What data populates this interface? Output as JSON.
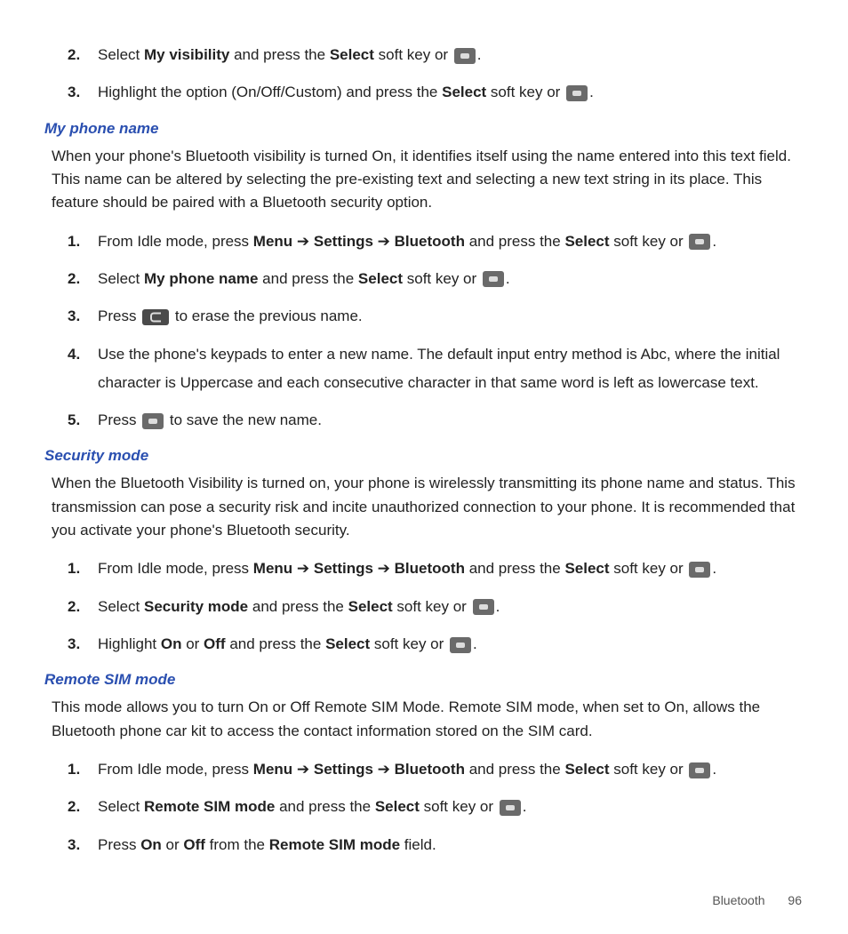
{
  "intro_steps": [
    {
      "n": "2.",
      "pre": "Select ",
      "b1": "My visibility",
      "mid": " and press the ",
      "b2": "Select",
      "post": " soft key or ",
      "icon": "ok",
      "tail": "."
    },
    {
      "n": "3.",
      "pre": "Highlight the option (On/Off/Custom) and press the ",
      "b1": "Select",
      "mid": "",
      "b2": "",
      "post": " soft key or ",
      "icon": "ok",
      "tail": "."
    }
  ],
  "sec_phone": {
    "heading": "My phone name",
    "para": "When your phone's Bluetooth visibility is turned On, it identifies itself using the name entered into this text field. This name can be altered by selecting the pre-existing text and selecting a new text string in its place. This feature should be paired with a Bluetooth security option.",
    "steps": [
      {
        "n": "1.",
        "type": "menu",
        "pre": "From Idle mode, press ",
        "m1": "Menu",
        "a1": " ➔ ",
        "m2": "Settings",
        "a2": " ➔ ",
        "m3": "Bluetooth",
        "mid": " and press the ",
        "b": "Select",
        "post": " soft key or ",
        "icon": "ok",
        "tail": "."
      },
      {
        "n": "2.",
        "type": "sel",
        "pre": "Select ",
        "b1": "My phone name",
        "mid": " and press the ",
        "b2": "Select",
        "post": " soft key or ",
        "icon": "ok",
        "tail": "."
      },
      {
        "n": "3.",
        "type": "press",
        "pre": "Press ",
        "icon": "c",
        "post": " to erase the previous name."
      },
      {
        "n": "4.",
        "type": "plain",
        "text": "Use the phone's keypads to enter a new name. The default input entry method is Abc, where the initial character is Uppercase and each consecutive character in that same word is left as lowercase text."
      },
      {
        "n": "5.",
        "type": "press",
        "pre": "Press ",
        "icon": "ok",
        "post": " to save the new name."
      }
    ]
  },
  "sec_security": {
    "heading": "Security mode",
    "para": "When the Bluetooth Visibility is turned on, your phone is wirelessly transmitting its phone name and status. This transmission can pose a security risk and incite unauthorized connection to your phone. It is recommended that you activate your phone's Bluetooth security.",
    "steps": [
      {
        "n": "1.",
        "type": "menu",
        "pre": "From Idle mode, press ",
        "m1": "Menu",
        "a1": " ➔ ",
        "m2": "Settings",
        "a2": " ➔ ",
        "m3": "Bluetooth",
        "mid": " and press the ",
        "b": "Select",
        "post": " soft key or ",
        "icon": "ok",
        "tail": "."
      },
      {
        "n": "2.",
        "type": "sel",
        "pre": "Select ",
        "b1": "Security mode",
        "mid": " and press the ",
        "b2": "Select",
        "post": " soft key or ",
        "icon": "ok",
        "tail": "."
      },
      {
        "n": "3.",
        "type": "onoff",
        "pre": "Highlight ",
        "b1": "On",
        "mid1": " or ",
        "b2": "Off",
        "mid2": " and press the ",
        "b3": "Select",
        "post": " soft key or ",
        "icon": "ok",
        "tail": "."
      }
    ]
  },
  "sec_sim": {
    "heading": "Remote SIM mode",
    "para": "This mode allows you to turn On or Off Remote SIM Mode. Remote SIM mode, when set to On, allows the Bluetooth phone car kit to access the contact information stored on the SIM card.",
    "steps": [
      {
        "n": "1.",
        "type": "menu",
        "pre": "From Idle mode, press ",
        "m1": "Menu",
        "a1": " ➔ ",
        "m2": "Settings",
        "a2": " ➔ ",
        "m3": "Bluetooth",
        "mid": " and press the ",
        "b": "Select",
        "post": " soft key or ",
        "icon": "ok",
        "tail": "."
      },
      {
        "n": "2.",
        "type": "sel",
        "pre": "Select ",
        "b1": "Remote SIM mode",
        "mid": " and press the ",
        "b2": "Select",
        "post": " soft key or ",
        "icon": "ok",
        "tail": "."
      },
      {
        "n": "3.",
        "type": "sim3",
        "pre": "Press ",
        "b1": "On",
        "mid1": " or ",
        "b2": "Off",
        "mid2": " from the ",
        "b3": "Remote SIM mode",
        "post": " field."
      }
    ]
  },
  "footer": {
    "section": "Bluetooth",
    "page": "96"
  }
}
